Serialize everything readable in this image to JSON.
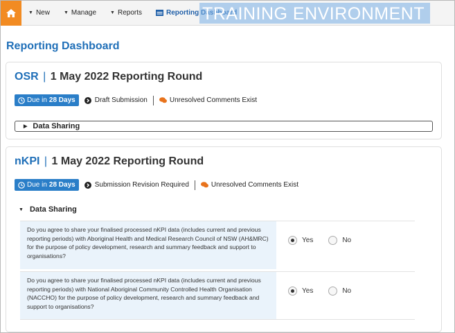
{
  "nav": {
    "items": [
      {
        "label": "New"
      },
      {
        "label": "Manage"
      },
      {
        "label": "Reports"
      }
    ],
    "active_label": "Reporting Dashboard",
    "banner": "TRAINING ENVIRONMENT"
  },
  "page": {
    "title": "Reporting Dashboard"
  },
  "panels": [
    {
      "code": "OSR",
      "sep": "|",
      "round": "1 May 2022 Reporting Round",
      "due_prefix": "Due in",
      "due_days": "28 Days",
      "status": "Draft Submission",
      "comments": "Unresolved Comments Exist",
      "section": "Data Sharing"
    },
    {
      "code": "nKPI",
      "sep": "|",
      "round": "1 May 2022 Reporting Round",
      "due_prefix": "Due in",
      "due_days": "28 Days",
      "status": "Submission Revision Required",
      "comments": "Unresolved Comments Exist",
      "section": "Data Sharing",
      "questions": [
        {
          "text": "Do you agree to share your finalised processed nKPI data (includes current and previous reporting periods) with Aboriginal Health and Medical Research Council of NSW (AH&MRC) for the purpose of policy development, research and summary feedback and support to organisations?",
          "yes": "Yes",
          "no": "No",
          "selected": "Yes"
        },
        {
          "text": "Do you agree to share your finalised processed nKPI data (includes current and previous reporting periods) with National Aboriginal Community Controlled Health Organisation (NACCHO) for the purpose of policy development, research and summary feedback and support to organisations?",
          "yes": "Yes",
          "no": "No",
          "selected": "Yes"
        }
      ]
    }
  ],
  "colors": {
    "home": "#f28b22",
    "accent": "#1f6fb8",
    "badge": "#2a7ec8",
    "comment_icon": "#e8731c",
    "question_bg": "#eaf3fb"
  }
}
